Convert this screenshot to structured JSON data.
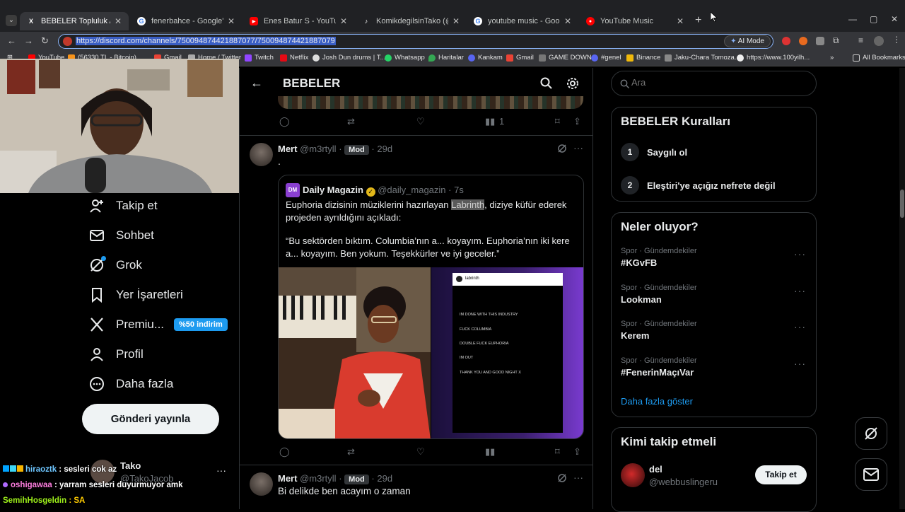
{
  "browser": {
    "tabs": [
      {
        "title": "BEBELER Topluluk / X",
        "active": true
      },
      {
        "title": "fenerbahce - Google'da Ara"
      },
      {
        "title": "Enes Batur S - YouTube"
      },
      {
        "title": "KomikdegilsinTako (@jacob.tal..."
      },
      {
        "title": "youtube music - Google'da Ara"
      },
      {
        "title": "YouTube Music"
      }
    ],
    "url": "https://discord.com/channels/750094874421887077/750094874421887079",
    "ai_mode": "AI Mode",
    "bookmarks": [
      "YouTube",
      "(56330 TL - Bitcoin)",
      "Gmail",
      "Home / Twitter",
      "Twitch",
      "Netflix",
      "Josh Dun drums | T...",
      "Whatsapp",
      "Haritalar",
      "Kankam",
      "Gmail",
      "GAME DOWN",
      "#genel",
      "Binance",
      "Jaku-Chara Tomoza...",
      "https://www.100yilh..."
    ],
    "all_bookmarks": "All Bookmarks"
  },
  "left_nav": {
    "items": [
      {
        "label": "Takip et",
        "icon": "person-plus-icon"
      },
      {
        "label": "Sohbet",
        "icon": "envelope-icon"
      },
      {
        "label": "Grok",
        "icon": "grok-icon"
      },
      {
        "label": "Yer İşaretleri",
        "icon": "bookmark-icon"
      },
      {
        "label": "Premiu...",
        "icon": "x-logo-icon"
      },
      {
        "label": "Profil",
        "icon": "person-icon"
      },
      {
        "label": "Daha fazla",
        "icon": "more-circle-icon"
      }
    ],
    "premium_badge": "%50 indirim",
    "post_button": "Gönderi yayınla",
    "account": {
      "name": "Tako",
      "handle": "@TakoJacob",
      "more": "···"
    }
  },
  "chat": [
    {
      "user": "hiraoztk",
      "message": ": sesleri cok az",
      "color": "#6ec6ff"
    },
    {
      "user": "oshigawaa",
      "message": ": yarram sesleri duyurmuyor amk",
      "color": "#ff7ee0"
    },
    {
      "user": "SemihHosgeldin",
      "message": ": SA",
      "color": "#9ef01a"
    }
  ],
  "header": {
    "title": "BEBELER",
    "back": "←"
  },
  "post1": {
    "views": "1",
    "author": "Mert",
    "handle": "@m3rtyll",
    "badge": "Mod",
    "time": "29d",
    "text": ".",
    "quote": {
      "name": "Daily Magazin",
      "handle": "@daily_magazin",
      "time": "7s",
      "avatar_text": "DM",
      "text_before": "Euphoria dizisinin müziklerini hazırlayan ",
      "highlight": "Labrinth",
      "text_after": ", diziye küfür ederek projeden ayrıldığını açıkladı:",
      "quote_text": "“Bu sektörden bıktım. Columbia’nın a... koyayım. Euphoria’nın iki kere a... koyayım. Ben yokum. Teşekkürler ve iyi geceler.”",
      "screenshot_lines": [
        "IM DONE WITH THIS INDUSTRY",
        "FUCK COLUMBIA",
        "DOUBLE FUCK EUPHORIA",
        "IM OUT",
        "THANK YOU AND GOOD NIGHT X"
      ],
      "screenshot_user": "labrinth"
    }
  },
  "post2": {
    "author": "Mert",
    "handle": "@m3rtyll",
    "badge": "Mod",
    "time": "29d",
    "text": "Bi delikde ben acayım o zaman"
  },
  "search": {
    "placeholder": "Ara"
  },
  "rules": {
    "title": "BEBELER Kuralları",
    "items": [
      {
        "num": "1",
        "text": "Saygılı ol"
      },
      {
        "num": "2",
        "text": "Eleştiri'ye açığız nefrete değil"
      }
    ]
  },
  "trends": {
    "title": "Neler oluyor?",
    "items": [
      {
        "category": "Spor · Gündemdekiler",
        "name": "#KGvFB"
      },
      {
        "category": "Spor · Gündemdekiler",
        "name": "Lookman"
      },
      {
        "category": "Spor · Gündemdekiler",
        "name": "Kerem"
      },
      {
        "category": "Spor · Gündemdekiler",
        "name": "#FenerinMaçıVar"
      }
    ],
    "show_more": "Daha fazla göster"
  },
  "who_to_follow": {
    "title": "Kimi takip etmeli",
    "user": {
      "name": "del",
      "handle": "@webbuslingeru"
    },
    "follow_button": "Takip et"
  },
  "colors": {
    "accent": "#1d9bf0",
    "background": "#000000",
    "border": "#2f3336",
    "muted": "#71767b"
  }
}
